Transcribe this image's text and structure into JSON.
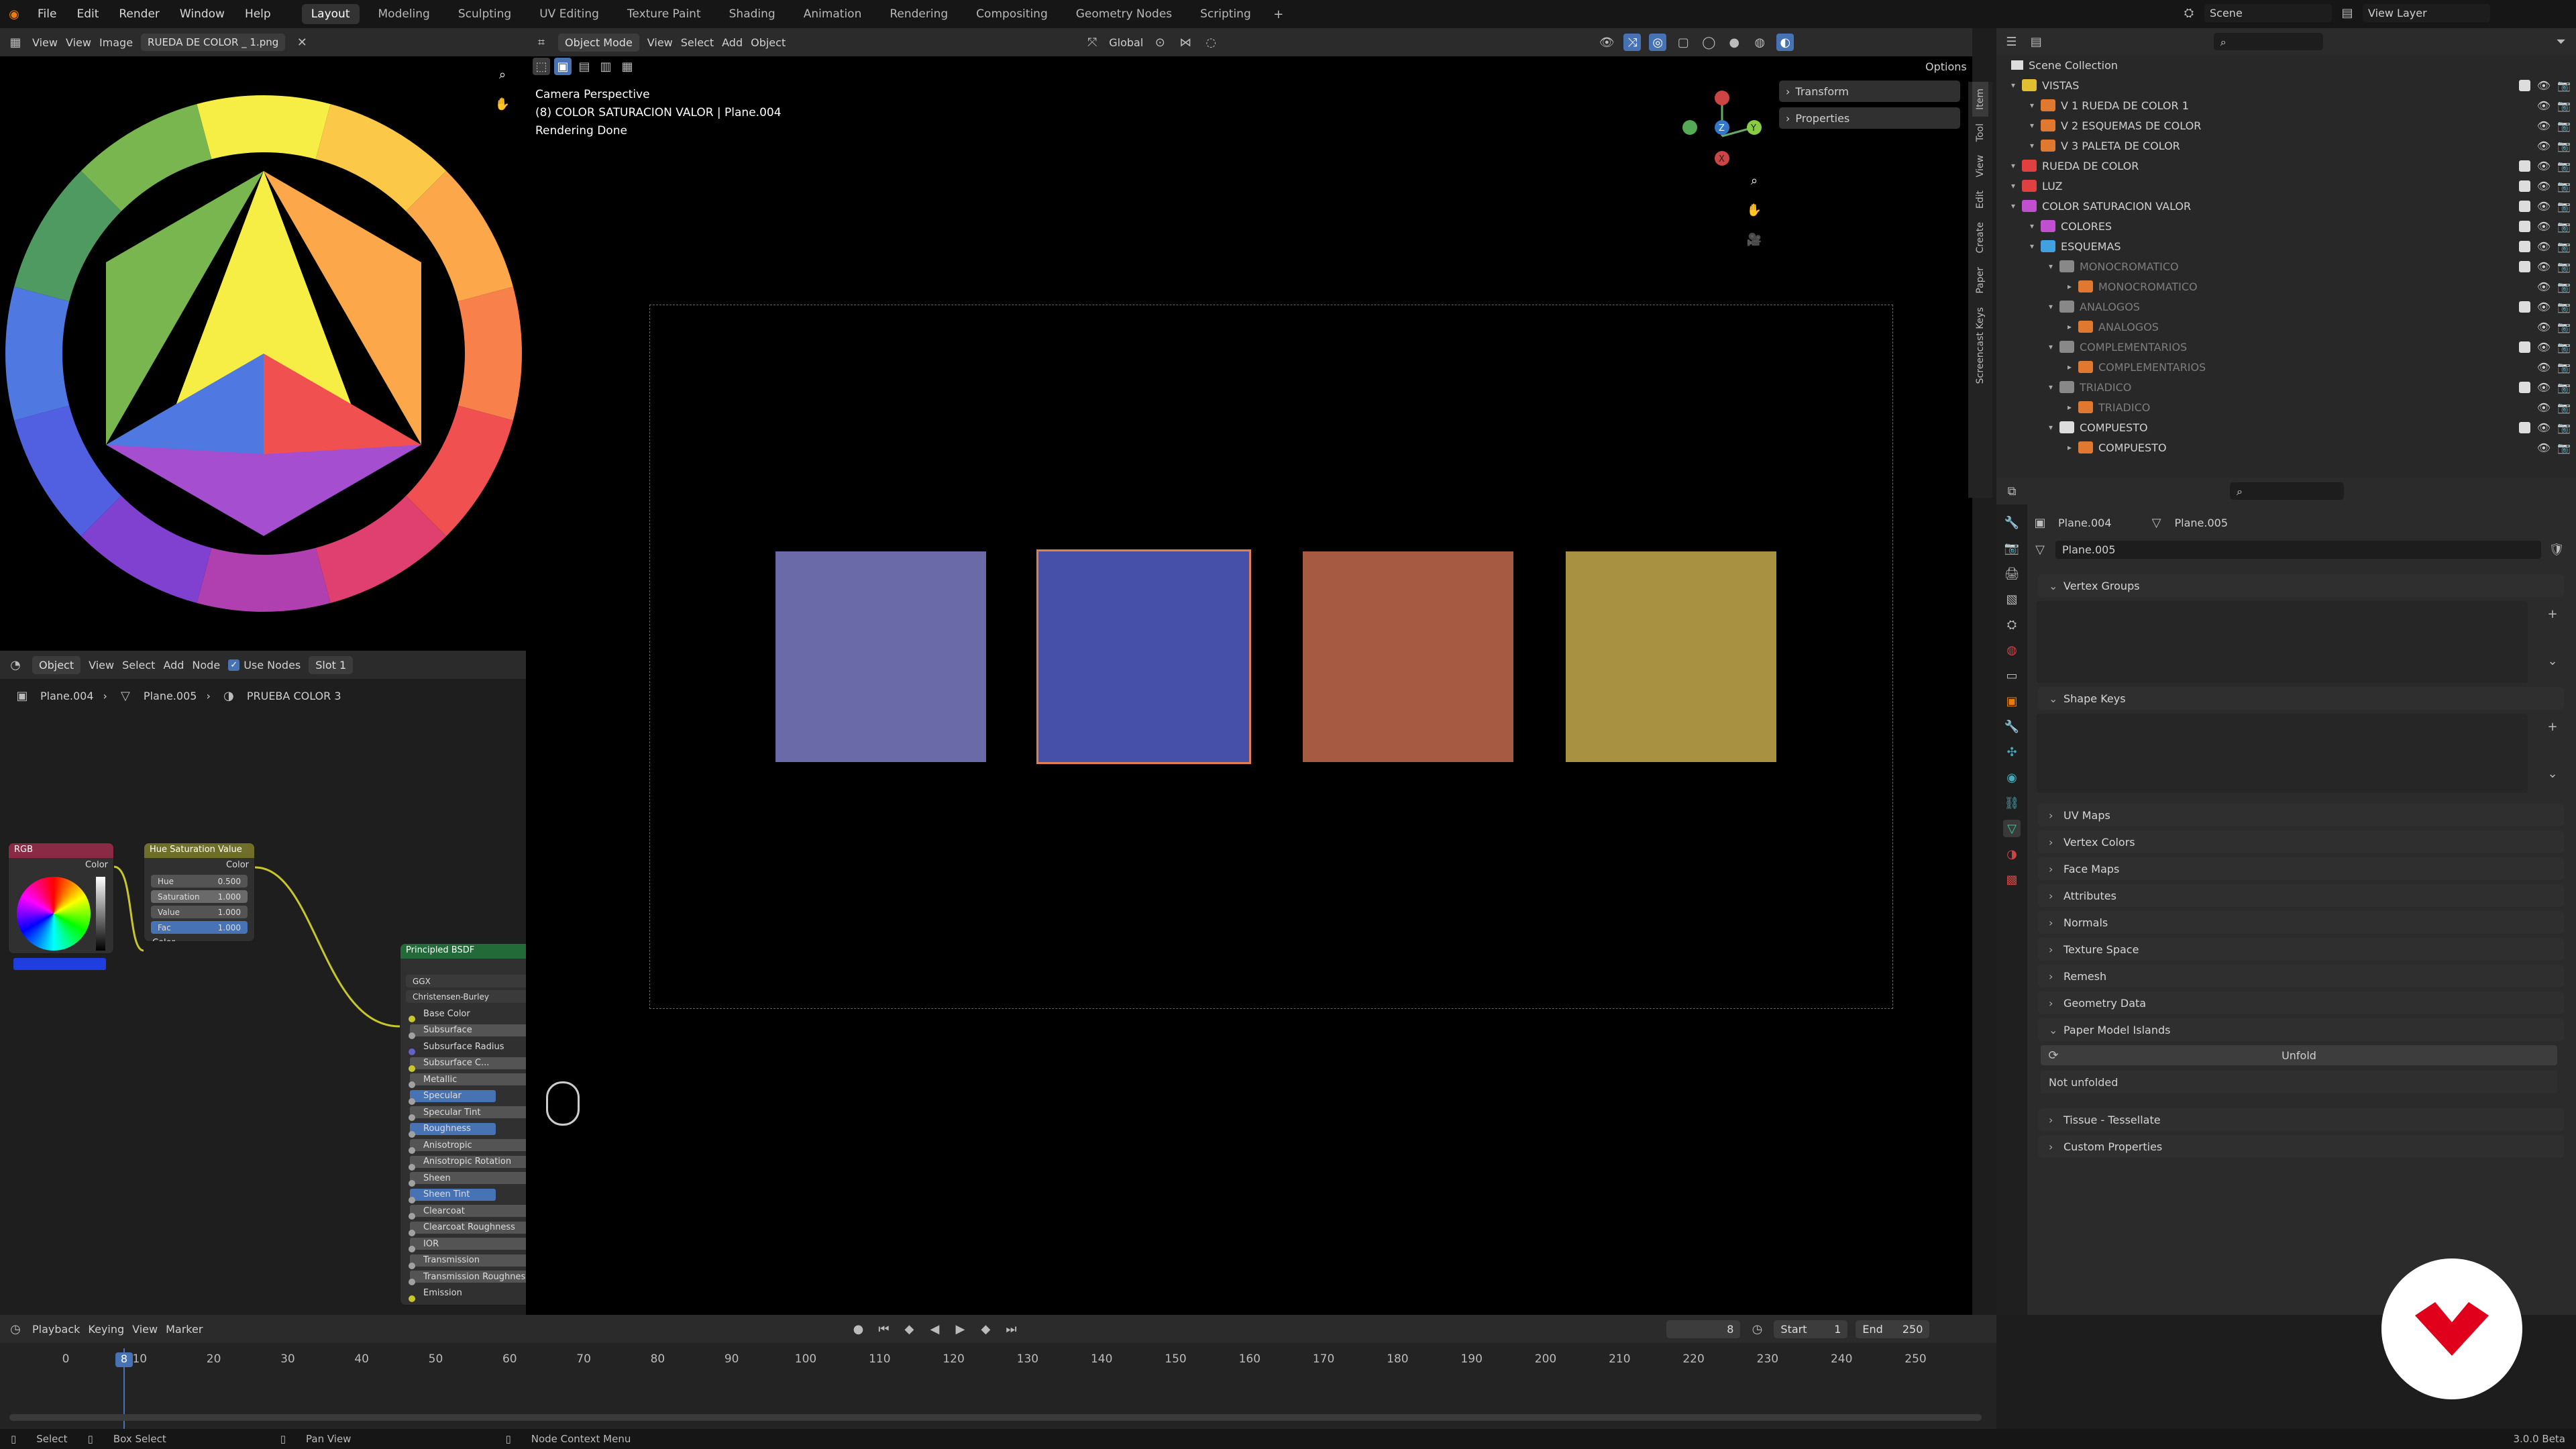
{
  "topbar": {
    "menus": [
      "File",
      "Edit",
      "Render",
      "Window",
      "Help"
    ],
    "workspaces": [
      "Layout",
      "Modeling",
      "Sculpting",
      "UV Editing",
      "Texture Paint",
      "Shading",
      "Animation",
      "Rendering",
      "Compositing",
      "Geometry Nodes",
      "Scripting"
    ],
    "active_workspace": "Layout",
    "scene": "Scene",
    "view_layer": "View Layer"
  },
  "image_editor": {
    "view": "View",
    "menus": [
      "View",
      "Image"
    ],
    "image_name": "RUEDA DE COLOR _ 1.png"
  },
  "node_editor": {
    "mode": "Object",
    "menus": [
      "View",
      "Select",
      "Add",
      "Node"
    ],
    "use_nodes": "Use Nodes",
    "slot": "Slot 1",
    "breadcrumb": [
      "Plane.004",
      "Plane.005",
      "PRUEBA COLOR 3"
    ],
    "rgb_node": {
      "title": "RGB",
      "output": "Color"
    },
    "hsv_node": {
      "title": "Hue Saturation Value",
      "output": "Color",
      "fields": [
        {
          "label": "Hue",
          "value": "0.500"
        },
        {
          "label": "Saturation",
          "value": "1.000"
        },
        {
          "label": "Value",
          "value": "1.000"
        },
        {
          "label": "Fac",
          "value": "1.000"
        }
      ],
      "input": "Color"
    },
    "bsdf_node": {
      "title": "Principled BSDF",
      "distribution": "GGX",
      "subsurface_method": "Christensen-Burley",
      "inputs": [
        "Base Color",
        "Subsurface",
        "Subsurface Radius",
        "Subsurface C...",
        "Metallic",
        "Specular",
        "Specular Tint",
        "Roughness",
        "Anisotropic",
        "Anisotropic Rotation",
        "Sheen",
        "Sheen Tint",
        "Clearcoat",
        "Clearcoat Roughness",
        "IOR",
        "Transmission",
        "Transmission Roughness",
        "Emission"
      ]
    }
  },
  "viewport": {
    "mode": "Object Mode",
    "menus": [
      "View",
      "Select",
      "Add",
      "Object"
    ],
    "orientation": "Global",
    "options": "Options",
    "info_line1": "Camera Perspective",
    "info_line2": "(8) COLOR SATURACION VALOR | Plane.004",
    "info_line3": "Rendering Done",
    "sidebar_panels": [
      "Transform",
      "Properties"
    ],
    "side_tabs": [
      "Item",
      "Tool",
      "View",
      "Edit",
      "Create",
      "Paper",
      "Screencast Keys"
    ],
    "squares": [
      {
        "color": "#6a6aa8"
      },
      {
        "color": "#4650a8"
      },
      {
        "color": "#a65a42"
      },
      {
        "color": "#a89242"
      }
    ]
  },
  "outliner": {
    "root": "Scene Collection",
    "items": [
      {
        "label": "VISTAS",
        "depth": 0,
        "color": "#e0c030",
        "dim": false,
        "check": true
      },
      {
        "label": "V 1 RUEDA DE COLOR 1",
        "depth": 1,
        "color": "#e07830",
        "dim": false,
        "check": false
      },
      {
        "label": "V 2 ESQUEMAS DE COLOR",
        "depth": 1,
        "color": "#e07830",
        "dim": false,
        "check": false
      },
      {
        "label": "V 3 PALETA DE COLOR",
        "depth": 1,
        "color": "#e07830",
        "dim": false,
        "check": false
      },
      {
        "label": "RUEDA DE COLOR",
        "depth": 0,
        "color": "#e04040",
        "dim": false,
        "check": true
      },
      {
        "label": "LUZ",
        "depth": 0,
        "color": "#e04040",
        "dim": false,
        "check": true
      },
      {
        "label": "COLOR SATURACION VALOR",
        "depth": 0,
        "color": "#c050d0",
        "dim": false,
        "check": true
      },
      {
        "label": "COLORES",
        "depth": 1,
        "color": "#c050d0",
        "dim": false,
        "check": true
      },
      {
        "label": "ESQUEMAS",
        "depth": 1,
        "color": "#40a0e0",
        "dim": false,
        "check": true
      },
      {
        "label": "MONOCROMATICO",
        "depth": 2,
        "color": "#888888",
        "dim": true,
        "check": true
      },
      {
        "label": "MONOCROMATICO",
        "depth": 3,
        "color": "#e07830",
        "dim": true,
        "check": false
      },
      {
        "label": "ANALOGOS",
        "depth": 2,
        "color": "#888888",
        "dim": true,
        "check": true
      },
      {
        "label": "ANALOGOS",
        "depth": 3,
        "color": "#e07830",
        "dim": true,
        "check": false
      },
      {
        "label": "COMPLEMENTARIOS",
        "depth": 2,
        "color": "#888888",
        "dim": true,
        "check": true
      },
      {
        "label": "COMPLEMENTARIOS",
        "depth": 3,
        "color": "#e07830",
        "dim": true,
        "check": false
      },
      {
        "label": "TRIADICO",
        "depth": 2,
        "color": "#888888",
        "dim": true,
        "check": true
      },
      {
        "label": "TRIADICO",
        "depth": 3,
        "color": "#e07830",
        "dim": true,
        "check": false
      },
      {
        "label": "COMPUESTO",
        "depth": 2,
        "color": "#dddddd",
        "dim": false,
        "check": true
      },
      {
        "label": "COMPUESTO",
        "depth": 3,
        "color": "#e07830",
        "dim": false,
        "check": false
      }
    ]
  },
  "properties": {
    "object": "Plane.004",
    "mesh": "Plane.005",
    "mesh_field": "Plane.005",
    "open_sections": [
      "Vertex Groups",
      "Shape Keys"
    ],
    "sections": [
      "UV Maps",
      "Vertex Colors",
      "Face Maps",
      "Attributes",
      "Normals",
      "Texture Space",
      "Remesh",
      "Geometry Data"
    ],
    "paper_model": "Paper Model Islands",
    "unfold": "Unfold",
    "not_unfolded": "Not unfolded",
    "tail_sections": [
      "Tissue - Tessellate",
      "Custom Properties"
    ]
  },
  "timeline": {
    "menus": [
      "Playback",
      "Keying",
      "View",
      "Marker"
    ],
    "current_frame": "8",
    "start_label": "Start",
    "start": "1",
    "end_label": "End",
    "end": "250",
    "ticks": [
      "0",
      "10",
      "20",
      "30",
      "40",
      "50",
      "60",
      "70",
      "80",
      "90",
      "100",
      "110",
      "120",
      "130",
      "140",
      "150",
      "160",
      "170",
      "180",
      "190",
      "200",
      "210",
      "220",
      "230",
      "240",
      "250"
    ]
  },
  "statusbar": {
    "items": [
      "Select",
      "Box Select",
      "Pan View",
      "Node Context Menu"
    ],
    "version": "3.0.0 Beta"
  }
}
